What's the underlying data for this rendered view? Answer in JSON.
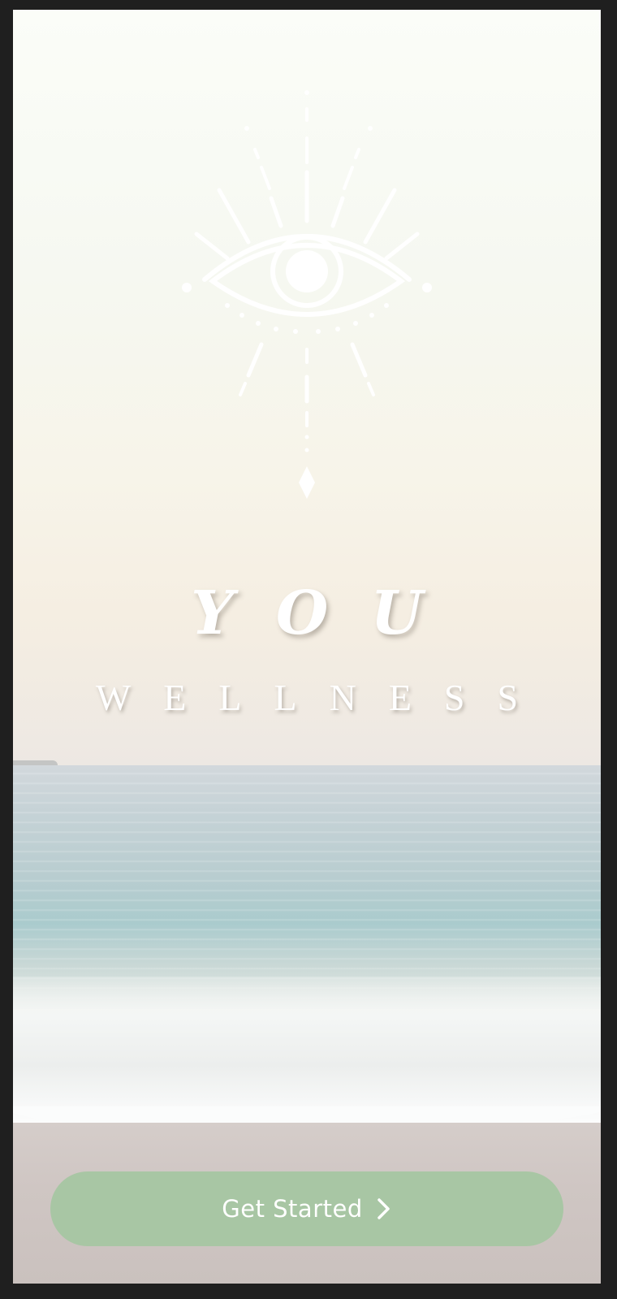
{
  "app": {
    "brand_primary": "YOU",
    "brand_secondary": "WELLNESS",
    "logo_icon": "evil-eye-icon"
  },
  "cta": {
    "label": "Get Started",
    "icon": "chevron-right-icon",
    "color": "#a8c6a4"
  },
  "colors": {
    "text": "#ffffff",
    "frame": "#1f1f1f"
  },
  "background": {
    "icon": "beach-ocean-photo"
  }
}
